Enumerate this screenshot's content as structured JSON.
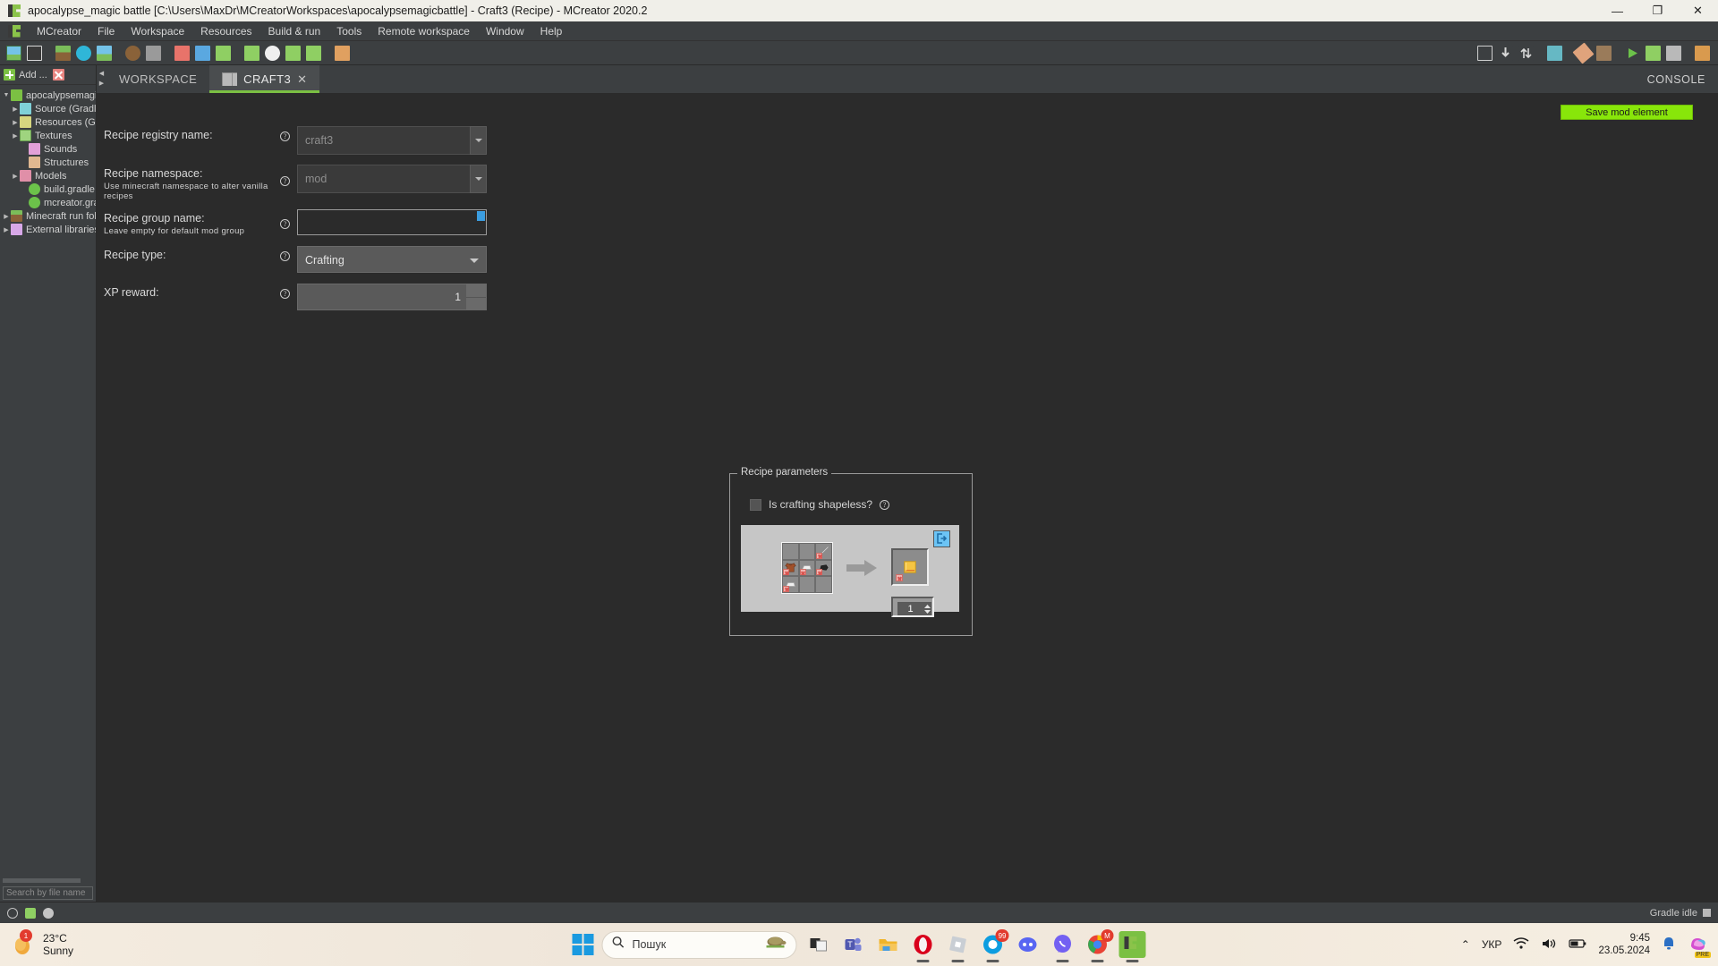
{
  "window": {
    "title": "apocalypse_magic battle [C:\\Users\\MaxDr\\MCreatorWorkspaces\\apocalypsemagicbattle] - Craft3 (Recipe) - MCreator 2020.2",
    "app_icon": "mcreator-logo-icon",
    "minimize": "—",
    "maximize": "❐",
    "close": "✕"
  },
  "menubar": {
    "items": [
      {
        "label": "MCreator"
      },
      {
        "label": "File"
      },
      {
        "label": "Workspace"
      },
      {
        "label": "Resources"
      },
      {
        "label": "Build & run"
      },
      {
        "label": "Tools"
      },
      {
        "label": "Remote workspace"
      },
      {
        "label": "Window"
      },
      {
        "label": "Help"
      }
    ]
  },
  "toolbar": {
    "left_icons": [
      "new-texture-icon",
      "new-animated-texture-icon",
      "import-block-texture-icon",
      "import-item-texture-icon",
      "import-other-texture-icon",
      "import-armor-texture-icon",
      "import-structure-icon",
      "block-texture-set-icon",
      "item-texture-set-icon",
      "entity-texture-set-icon",
      "add-sound-icon",
      "add-structure-icon",
      "add-model-icon",
      "add-armor-model-icon",
      "add-variable-icon"
    ],
    "right_icons": [
      "workspace-tree-icon",
      "download-icon",
      "sync-icon",
      "gradle-folder-icon",
      "eraser-icon",
      "hammer-icon",
      "run-client-icon",
      "run-server-icon",
      "stop-icon",
      "export-icon"
    ]
  },
  "sidebar": {
    "add_label": "Add ...",
    "add_icon": "plus-icon",
    "remove_icon": "close-x-icon",
    "tree": [
      {
        "label": "apocalypsemagicba",
        "icon": "workspace-icon",
        "arrow": "▼",
        "depth": 0
      },
      {
        "label": "Source (Gradle)",
        "icon": "source-folder-icon",
        "arrow": "▶",
        "depth": 1
      },
      {
        "label": "Resources (Gradl",
        "icon": "resources-folder-icon",
        "arrow": "▶",
        "depth": 1
      },
      {
        "label": "Textures",
        "icon": "textures-folder-icon",
        "arrow": "▶",
        "depth": 1
      },
      {
        "label": "Sounds",
        "icon": "sounds-folder-icon",
        "arrow": "",
        "depth": 2
      },
      {
        "label": "Structures",
        "icon": "structures-folder-icon",
        "arrow": "",
        "depth": 2
      },
      {
        "label": "Models",
        "icon": "models-folder-icon",
        "arrow": "▶",
        "depth": 1
      },
      {
        "label": "build.gradle",
        "icon": "gradle-file-icon",
        "arrow": "",
        "depth": 2
      },
      {
        "label": "mcreator.gradle",
        "icon": "gradle-file-icon",
        "arrow": "",
        "depth": 2
      },
      {
        "label": "Minecraft run folder",
        "icon": "run-folder-icon",
        "arrow": "▶",
        "depth": 0
      },
      {
        "label": "External libraries",
        "icon": "libraries-folder-icon",
        "arrow": "▶",
        "depth": 0
      }
    ],
    "search_placeholder": "Search by file name"
  },
  "tabs": {
    "items": [
      {
        "label": "WORKSPACE",
        "active": false,
        "icon": ""
      },
      {
        "label": "CRAFT3",
        "active": true,
        "icon": "recipe-grid-icon",
        "close": "✕"
      }
    ],
    "console_label": "CONSOLE"
  },
  "editor": {
    "save_button": "Save mod element",
    "fields": [
      {
        "label": "Recipe registry name:",
        "sub": "",
        "help": "?",
        "value": "craft3",
        "placeholder": "craft3",
        "type": "combo-text"
      },
      {
        "label": "Recipe namespace:",
        "sub": "Use minecraft namespace to alter vanilla recipes",
        "help": "?",
        "value": "mod",
        "placeholder": "mod",
        "type": "combo-text"
      },
      {
        "label": "Recipe group name:",
        "sub": "Leave empty for default mod group",
        "help": "?",
        "value": "",
        "placeholder": "",
        "type": "text-focused"
      },
      {
        "label": "Recipe type:",
        "sub": "",
        "help": "?",
        "value": "Crafting",
        "type": "select"
      },
      {
        "label": "XP reward:",
        "sub": "",
        "help": "?",
        "value": "1",
        "type": "spinner"
      }
    ]
  },
  "recipe_panel": {
    "legend": "Recipe parameters",
    "shapeless_label": "Is crafting shapeless?",
    "shapeless_checked": false,
    "help": "?",
    "export_icon": "export-recipe-icon",
    "grid": [
      {
        "slot": 0,
        "item": "",
        "filled": false
      },
      {
        "slot": 1,
        "item": "",
        "filled": false
      },
      {
        "slot": 2,
        "item": "iron-sword",
        "filled": true
      },
      {
        "slot": 3,
        "item": "leather-tunic",
        "filled": true
      },
      {
        "slot": 4,
        "item": "iron-ingot",
        "filled": true
      },
      {
        "slot": 5,
        "item": "coal",
        "filled": true
      },
      {
        "slot": 6,
        "item": "iron-ingot",
        "filled": true
      },
      {
        "slot": 7,
        "item": "",
        "filled": false
      },
      {
        "slot": 8,
        "item": "",
        "filled": false
      }
    ],
    "arrow_icon": "arrow-right-icon",
    "output": {
      "item": "golden-item",
      "filled": true
    },
    "output_count": "1"
  },
  "statusbar": {
    "icons": [
      "info-icon",
      "update-icon",
      "settings-gear-icon"
    ],
    "gradle_status": "Gradle idle"
  },
  "taskbar": {
    "weather": {
      "temp": "23°C",
      "condition": "Sunny",
      "badge": "1",
      "icon": "sun-icon"
    },
    "start_icon": "windows-start-icon",
    "search_placeholder": "Пошук",
    "search_icon": "search-icon",
    "search_image": "turtle-icon",
    "apps": [
      {
        "name": "task-view-icon",
        "active": false
      },
      {
        "name": "microsoft-teams-icon",
        "active": false
      },
      {
        "name": "file-explorer-icon",
        "active": false
      },
      {
        "name": "opera-browser-icon",
        "active": true
      },
      {
        "name": "roblox-icon",
        "active": true
      },
      {
        "name": "opera-gx-icon",
        "active": true,
        "badge": "99"
      },
      {
        "name": "discord-icon",
        "active": false
      },
      {
        "name": "viber-icon",
        "active": true
      },
      {
        "name": "chrome-icon",
        "active": true,
        "badge": "M"
      },
      {
        "name": "mcreator-icon",
        "active": true
      }
    ],
    "tray": {
      "chevron": "⌃",
      "language": "УКР",
      "wifi_icon": "wifi-icon",
      "volume_icon": "volume-icon",
      "battery_icon": "battery-icon",
      "time": "9:45",
      "date": "23.05.2024",
      "notification_icon": "bell-icon",
      "copilot_icon": "copilot-icon",
      "copilot_badge": "PRE"
    }
  },
  "colors": {
    "accent_green": "#88e60a",
    "tab_accent": "#7bc043",
    "panel_bg": "#2b2b2b",
    "chrome_bg": "#3c3f41"
  }
}
